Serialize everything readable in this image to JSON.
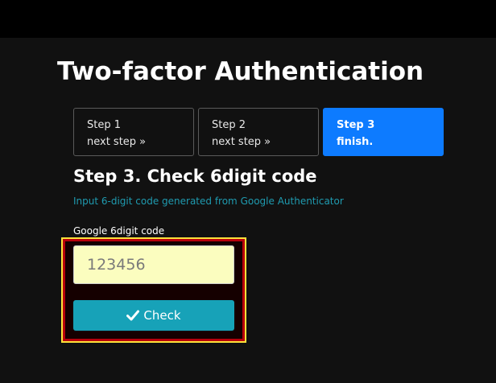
{
  "page": {
    "title": "Two-factor Authentication"
  },
  "steps": [
    {
      "title": "Step 1",
      "subtitle": "next step »",
      "active": false
    },
    {
      "title": "Step 2",
      "subtitle": "next step »",
      "active": false
    },
    {
      "title": "Step 3",
      "subtitle": "finish.",
      "active": true
    }
  ],
  "section": {
    "heading": "Step 3. Check 6digit code",
    "help": "Input 6-digit code generated from Google Authenticator"
  },
  "form": {
    "code_label": "Google 6digit code",
    "code_placeholder": "123456",
    "code_value": "",
    "check_label": "Check",
    "check_icon": "check-icon"
  },
  "colors": {
    "background": "#111111",
    "topbar": "#000000",
    "active_step": "#0d7bff",
    "help_text": "#1f9bb0",
    "button": "#17a2b8",
    "input_background": "#fbfdbf",
    "highlight_border": "#ffe23a",
    "highlight_fill": "#b8000b"
  }
}
